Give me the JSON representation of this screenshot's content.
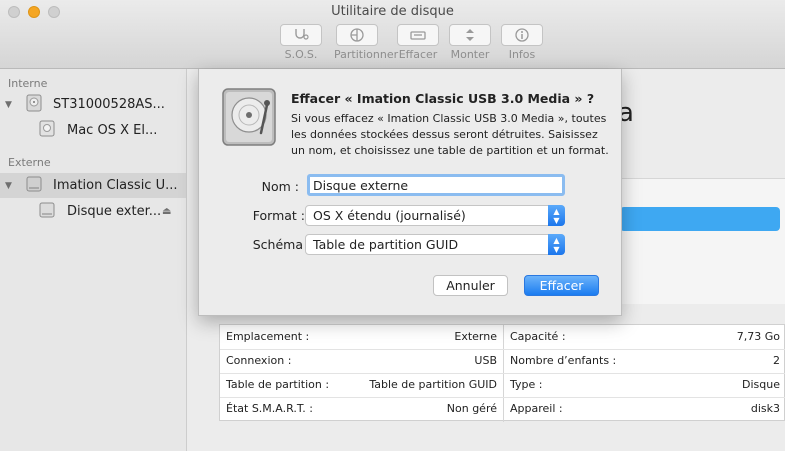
{
  "window": {
    "title": "Utilitaire de disque"
  },
  "toolbar": [
    {
      "label": "S.O.S.",
      "icon": "stethoscope-icon"
    },
    {
      "label": "Partitionner",
      "icon": "partition-pie-icon"
    },
    {
      "label": "Effacer",
      "icon": "erase-icon"
    },
    {
      "label": "Monter",
      "icon": "mount-icon"
    },
    {
      "label": "Infos",
      "icon": "info-icon"
    }
  ],
  "sidebar": {
    "internal_header": "Interne",
    "external_header": "Externe",
    "items": [
      {
        "label": "ST31000528AS..."
      },
      {
        "label": "Mac OS X El..."
      },
      {
        "label": "Imation Classic U..."
      },
      {
        "label": "Disque exter..."
      }
    ]
  },
  "sheet": {
    "title": "Effacer « Imation Classic USB 3.0 Media » ?",
    "message": "Si vous effacez « Imation Classic USB 3.0 Media », toutes les données stockées dessus seront détruites. Saisissez un nom, et choisissez une table de partition et un format.",
    "name_label": "Nom :",
    "name_value": "Disque externe",
    "format_label": "Format :",
    "format_value": "OS X étendu (journalisé)",
    "scheme_label": "Schéma",
    "scheme_value": "Table de partition GUID",
    "cancel_label": "Annuler",
    "erase_label": "Effacer"
  },
  "background": {
    "partial_title": "a"
  },
  "info_table": {
    "rows": [
      {
        "left_label": "Emplacement :",
        "left_value": "Externe",
        "right_label": "Capacité :",
        "right_value": "7,73 Go"
      },
      {
        "left_label": "Connexion :",
        "left_value": "USB",
        "right_label": "Nombre d’enfants :",
        "right_value": "2"
      },
      {
        "left_label": "Table de partition :",
        "left_value": "Table de partition GUID",
        "right_label": "Type :",
        "right_value": "Disque"
      },
      {
        "left_label": "État S.M.A.R.T. :",
        "left_value": "Non géré",
        "right_label": "Appareil :",
        "right_value": "disk3"
      }
    ]
  },
  "colors": {
    "accent": "#1b7cf0",
    "selection": "#d4d4d4",
    "bar": "#3ea8f2"
  }
}
